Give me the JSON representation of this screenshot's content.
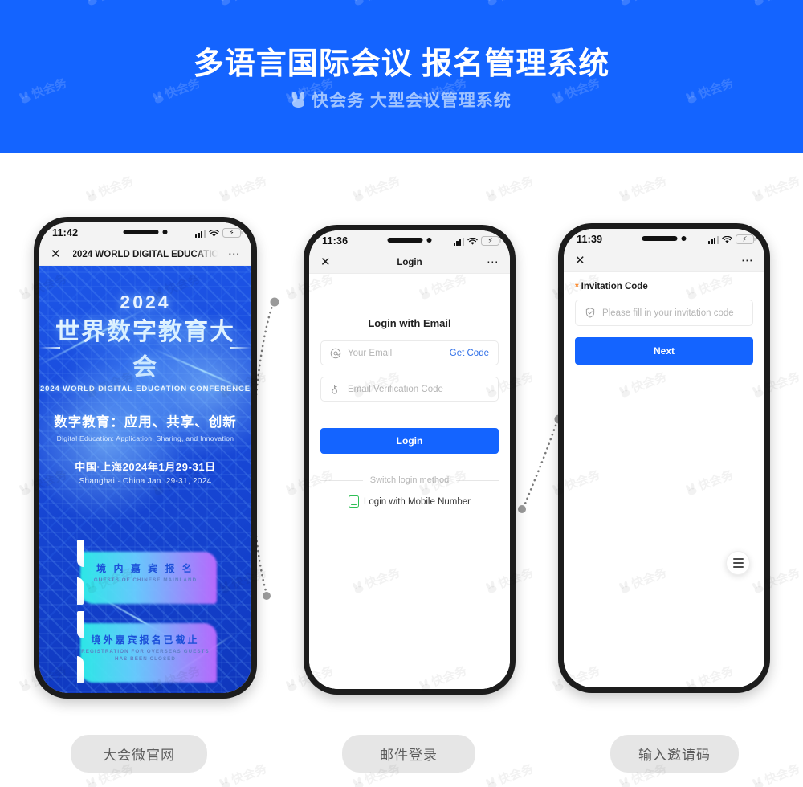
{
  "header": {
    "title": "多语言国际会议 报名管理系统",
    "subtitle": "快会务 大型会议管理系统",
    "logo_icon": "bunny-logo-icon",
    "bg_color": "#1464ff",
    "subtitle_color": "#9fc3ff"
  },
  "watermark": {
    "text": "快会务",
    "icon": "bunny-watermark-icon"
  },
  "phones": [
    {
      "id": "phone-1",
      "status_bar": {
        "time": "11:42",
        "signal_icon": "signal-bars-icon",
        "wifi_icon": "wifi-icon",
        "battery_icon": "battery-charging-icon",
        "battery_bolt": "⚡"
      },
      "nav": {
        "close_icon": "close-icon",
        "title": "2024 WORLD DIGITAL EDUCATIO",
        "more_icon": "more-options-icon"
      },
      "poster": {
        "year": "2024",
        "main_title": "世界数字教育大会",
        "main_title_en": "2024 WORLD DIGITAL EDUCATION CONFERENCE",
        "theme": "数字教育：应用、共享、创新",
        "theme_en": "Digital Education: Application, Sharing, and Innovation",
        "date_cn": "中国·上海2024年1月29-31日",
        "date_en": "Shanghai · China Jan. 29-31, 2024"
      },
      "buttons": [
        {
          "cn": "境 内 嘉 宾 报 名",
          "en": "GUESTS OF CHINESE MAINLAND"
        },
        {
          "cn": "境外嘉宾报名已截止",
          "en": "REGISTRATION FOR OVERSEAS GUESTS HAS BEEN CLOSED"
        }
      ]
    },
    {
      "id": "phone-2",
      "status_bar": {
        "time": "11:36",
        "signal_icon": "signal-bars-icon",
        "wifi_icon": "wifi-icon",
        "battery_icon": "battery-charging-icon",
        "battery_bolt": "⚡"
      },
      "nav": {
        "close_icon": "close-icon",
        "title": "Login",
        "more_icon": "more-options-icon"
      },
      "heading": "Login with Email",
      "email_field": {
        "icon": "at-sign-icon",
        "placeholder": "Your Email",
        "value": "",
        "action": "Get Code",
        "action_color": "#2f6fe8"
      },
      "code_field": {
        "icon": "key-icon",
        "placeholder": "Email Verification Code",
        "value": ""
      },
      "login_button": {
        "label": "Login",
        "color": "#1464ff"
      },
      "switch_label": "Switch login method",
      "alt_login": {
        "icon": "mobile-phone-icon",
        "label": "Login with Mobile Number",
        "icon_color": "#2fbf55"
      }
    },
    {
      "id": "phone-3",
      "status_bar": {
        "time": "11:39",
        "signal_icon": "signal-bars-icon",
        "wifi_icon": "wifi-icon",
        "battery_icon": "battery-charging-icon",
        "battery_bolt": "⚡"
      },
      "nav": {
        "close_icon": "close-icon",
        "title": "",
        "more_icon": "more-options-icon"
      },
      "field_label": "Invitation Code",
      "required_mark": "*",
      "invite_field": {
        "icon": "shield-check-icon",
        "placeholder": "Please fill in your invitation code",
        "value": ""
      },
      "next_button": {
        "label": "Next",
        "color": "#1464ff"
      },
      "fab": {
        "icon": "hamburger-menu-icon"
      }
    }
  ],
  "captions": [
    {
      "label": "大会微官网"
    },
    {
      "label": "邮件登录"
    },
    {
      "label": "输入邀请码"
    }
  ]
}
